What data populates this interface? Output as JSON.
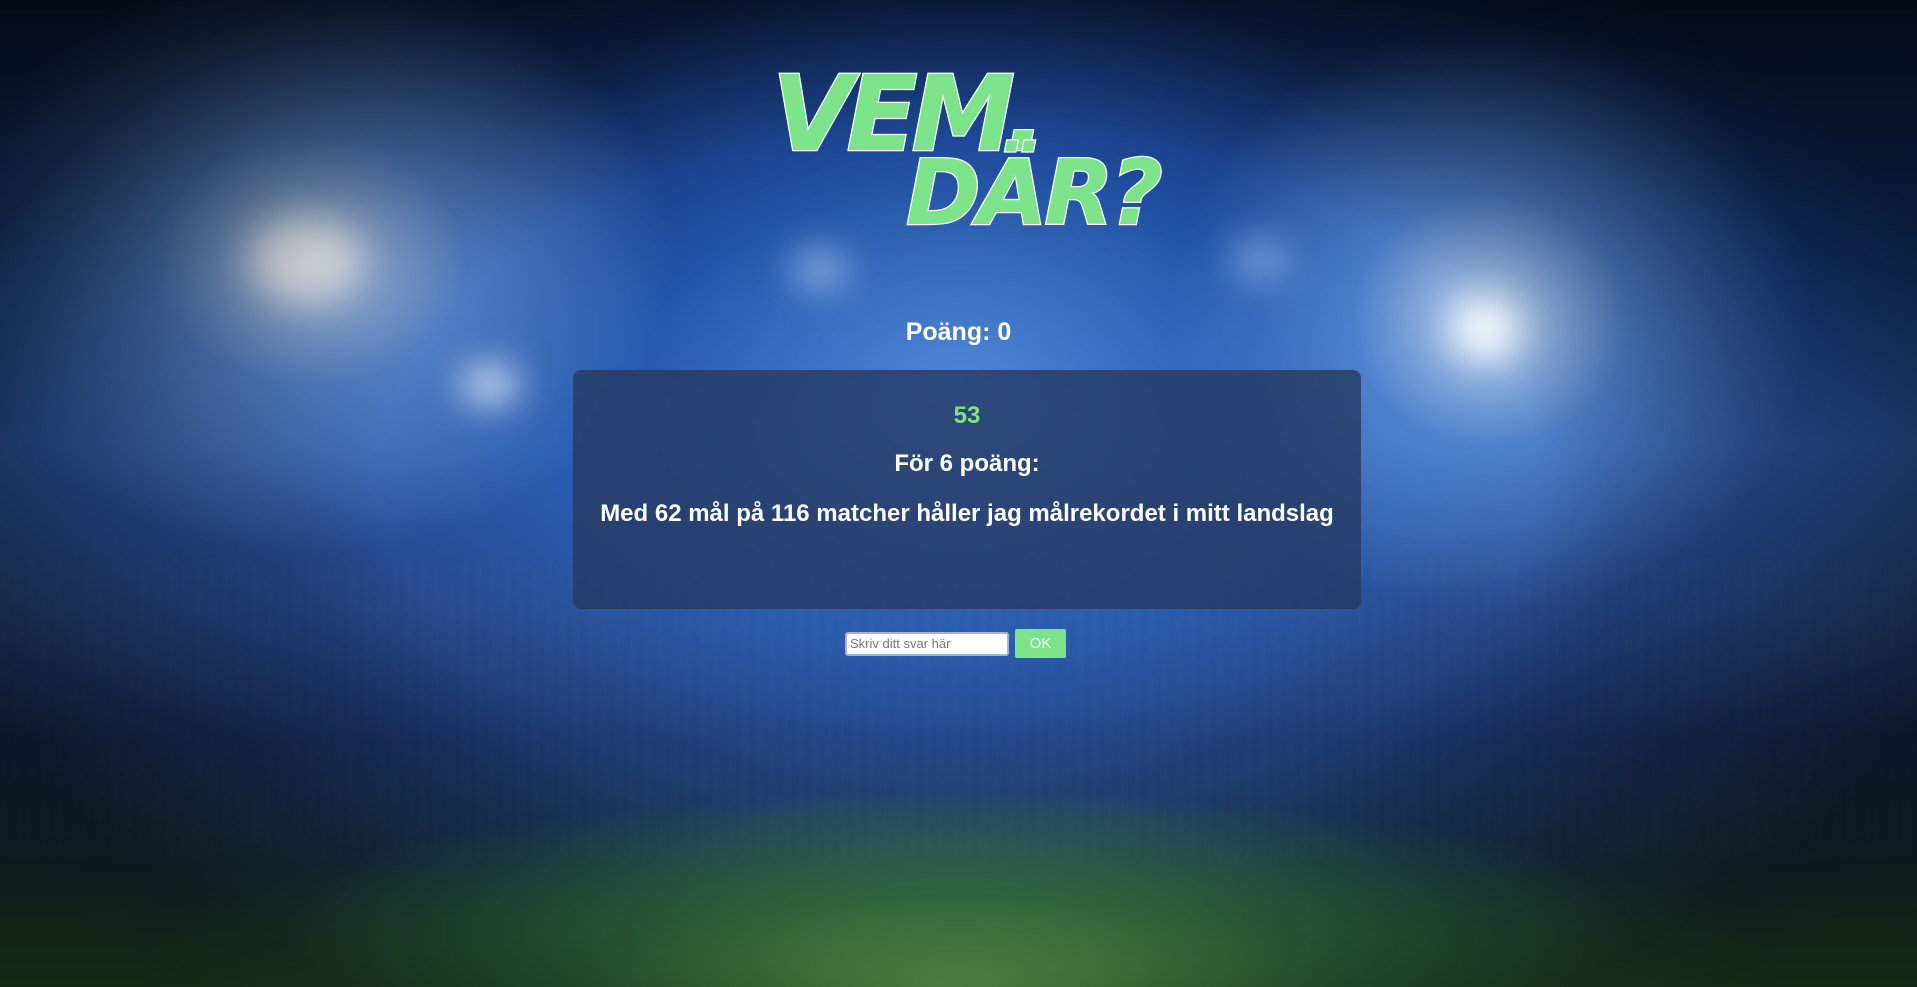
{
  "logo": {
    "line1": "VEM",
    "dot": ".",
    "line2": "DÄR?"
  },
  "score": {
    "text": "Poäng: 0"
  },
  "question": {
    "countdown": "53",
    "points_label": "För 6 poäng:",
    "clue": "Med 62 mål på 116 matcher håller jag målrekordet i mitt landslag"
  },
  "answer": {
    "placeholder": "Skriv ditt svar här",
    "value": "",
    "submit_label": "OK"
  },
  "colors": {
    "accent": "#7de38a",
    "card": "#25385f",
    "text": "#ffffff"
  }
}
